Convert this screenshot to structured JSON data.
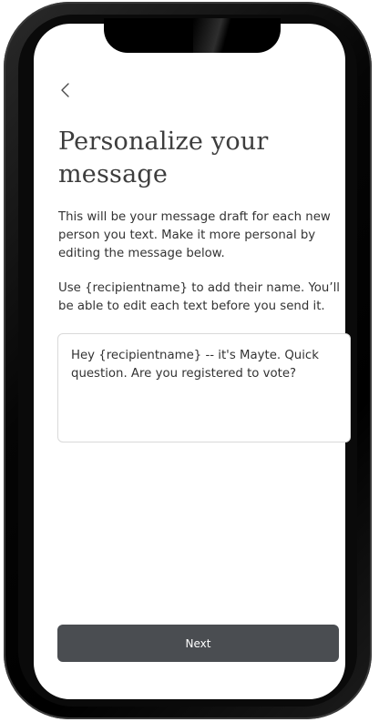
{
  "header": {
    "back_icon": "chevron-left-icon"
  },
  "main": {
    "title": "Personalize your message",
    "description": "This will be your message draft for each new person you text. Make it more personal by editing the message below.",
    "instructions": "Use {recipientname} to add their name. You’ll be able to edit each text before you send it.",
    "message_value": "Hey {recipientname} -- it's Mayte. Quick question. Are you registered to vote?"
  },
  "footer": {
    "next_label": "Next"
  },
  "colors": {
    "button_bg": "#4a4d51",
    "text": "#333333",
    "frame": "#000000"
  }
}
